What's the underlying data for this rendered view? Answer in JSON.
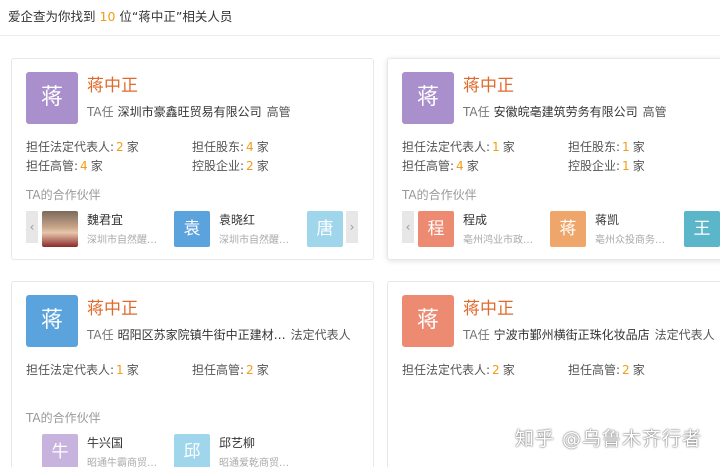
{
  "header": {
    "prefix": "爱企查为你找到",
    "count": "10",
    "suffix": "位“蒋中正”相关人员"
  },
  "cards": [
    {
      "avatar_char": "蒋",
      "name": "蒋中正",
      "role_prefix": "TA任",
      "company": "深圳市豪鑫旺贸易有限公司",
      "role": "高管",
      "stats": [
        {
          "label": "担任法定代表人:",
          "value": "2",
          "unit": "家"
        },
        {
          "label": "担任股东:",
          "value": "4",
          "unit": "家"
        },
        {
          "label": "担任高管:",
          "value": "4",
          "unit": "家"
        },
        {
          "label": "控股企业:",
          "value": "2",
          "unit": "家"
        }
      ],
      "partners_title": "TA的合作伙伴",
      "partners": [
        {
          "avatar": "",
          "name": "魏君宜",
          "company": "深圳市自然醒…"
        },
        {
          "avatar": "袁",
          "name": "袁晓红",
          "company": "深圳市自然醒…"
        },
        {
          "avatar": "唐",
          "name": "",
          "company": ""
        }
      ]
    },
    {
      "avatar_char": "蒋",
      "name": "蒋中正",
      "role_prefix": "TA任",
      "company": "安徽皖亳建筑劳务有限公司",
      "role": "高管",
      "stats": [
        {
          "label": "担任法定代表人:",
          "value": "1",
          "unit": "家"
        },
        {
          "label": "担任股东:",
          "value": "1",
          "unit": "家"
        },
        {
          "label": "担任高管:",
          "value": "4",
          "unit": "家"
        },
        {
          "label": "控股企业:",
          "value": "1",
          "unit": "家"
        }
      ],
      "partners_title": "TA的合作伙伴",
      "partners": [
        {
          "avatar": "程",
          "name": "程成",
          "company": "亳州鸿业市政…"
        },
        {
          "avatar": "蒋",
          "name": "蒋凯",
          "company": "亳州众投商务…"
        },
        {
          "avatar": "王",
          "name": "",
          "company": ""
        }
      ]
    },
    {
      "avatar_char": "蒋",
      "name": "蒋中正",
      "role_prefix": "TA任",
      "company": "昭阳区苏家院镇牛街中正建材…",
      "role": "法定代表人",
      "stats": [
        {
          "label": "担任法定代表人:",
          "value": "1",
          "unit": "家"
        },
        {
          "label": "担任高管:",
          "value": "2",
          "unit": "家"
        }
      ],
      "partners_title": "TA的合作伙伴",
      "partners": [
        {
          "avatar": "牛",
          "name": "牛兴国",
          "company": "昭通牛霸商贸…"
        },
        {
          "avatar": "邱",
          "name": "邱艺柳",
          "company": "昭通爱乾商贸…"
        }
      ]
    },
    {
      "avatar_char": "蒋",
      "name": "蒋中正",
      "role_prefix": "TA任",
      "company": "宁波市鄞州横街正珠化妆品店",
      "role": "法定代表人",
      "stats": [
        {
          "label": "担任法定代表人:",
          "value": "2",
          "unit": "家"
        },
        {
          "label": "担任高管:",
          "value": "2",
          "unit": "家"
        }
      ]
    }
  ],
  "arrows": {
    "left": "‹",
    "right": "›"
  },
  "watermark": "知乎 @乌鲁木齐行者",
  "colors": {
    "accent": "#e06a2c",
    "count": "#f39c12",
    "avatar_purple": "#a98fcb",
    "avatar_blue": "#5ba3dd",
    "avatar_salmon": "#ec8a72",
    "avatar_teal": "#5bb6c9",
    "avatar_orange": "#efa66a",
    "avatar_lightblue": "#9fd6ec",
    "avatar_lightpurple": "#c8b3df"
  }
}
